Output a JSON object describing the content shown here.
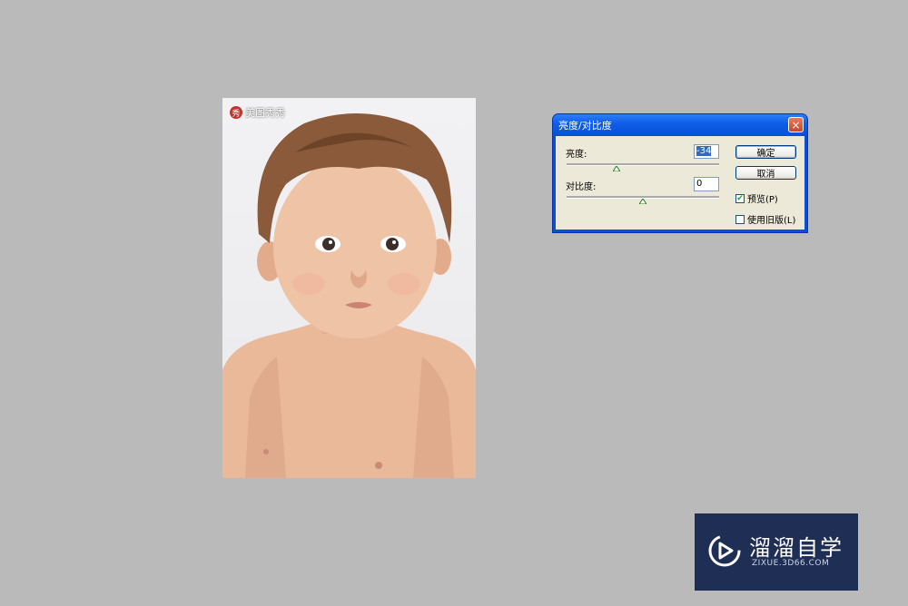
{
  "photo": {
    "watermark_text": "美图秀秀",
    "watermark_logo": "秀"
  },
  "dialog": {
    "title": "亮度/对比度",
    "close_icon": "×",
    "brightness": {
      "label": "亮度:",
      "value": "-34",
      "level": 0.33
    },
    "contrast": {
      "label": "对比度:",
      "value": "0",
      "level": 0.5
    },
    "ok_label": "确定",
    "cancel_label": "取消",
    "preview": {
      "label": "预览(P)",
      "checked": true,
      "check_glyph": "✔"
    },
    "legacy": {
      "label": "使用旧版(L)",
      "checked": false
    }
  },
  "brand": {
    "name": "溜溜自学",
    "url": "ZIXUE.3D66.COM"
  }
}
